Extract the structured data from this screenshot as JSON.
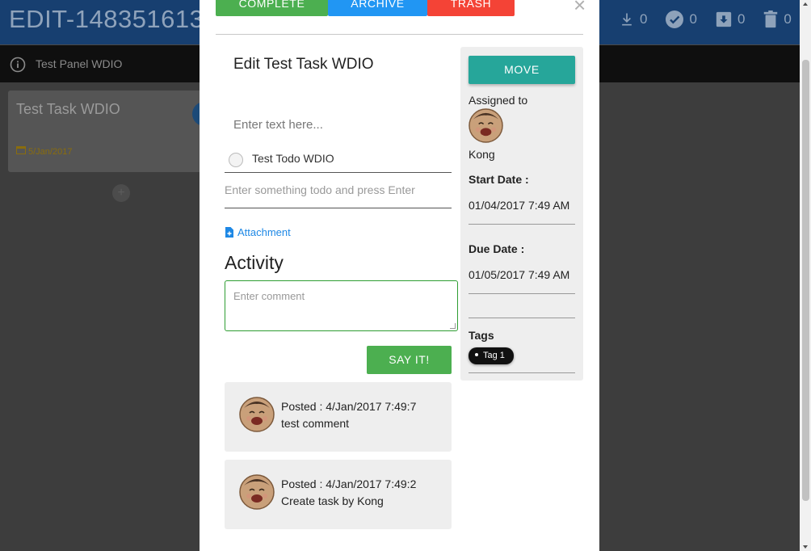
{
  "app": {
    "title": "EDIT-148351613",
    "counters": [
      {
        "icon": "download-icon",
        "value": "0"
      },
      {
        "icon": "check-circle-icon",
        "value": "0"
      },
      {
        "icon": "archive-icon",
        "value": "0"
      },
      {
        "icon": "trash-icon",
        "value": "0"
      }
    ],
    "panel_title": "Test Panel WDIO",
    "card": {
      "title": "Test Task WDIO",
      "date": "5/Jan/2017"
    },
    "add_symbol": "+"
  },
  "modal": {
    "buttons": {
      "complete": "COMPLETE",
      "archive": "ARCHIVE",
      "trash": "TRASH"
    },
    "close_symbol": "×",
    "task_title": "Edit Test Task WDIO",
    "text_placeholder": "Enter text here...",
    "todo": {
      "label": "Test Todo WDIO",
      "checked": false
    },
    "todo_placeholder": "Enter something todo and press Enter",
    "attachment_label": "Attachment",
    "activity_heading": "Activity",
    "comment_placeholder": "Enter comment",
    "say_button": "SAY IT!",
    "comments": [
      {
        "posted": "Posted : 4/Jan/2017 7:49:7",
        "text": "test comment"
      },
      {
        "posted": "Posted : 4/Jan/2017 7:49:2",
        "text": "Create task by Kong"
      }
    ]
  },
  "side": {
    "move_button": "MOVE",
    "assigned_label": "Assigned to",
    "assignee": "Kong",
    "start_label": "Start Date :",
    "start_value": "01/04/2017 7:49 AM",
    "due_label": "Due Date :",
    "due_value": "01/05/2017 7:49 AM",
    "tags_label": "Tags",
    "tags": [
      "Tag 1"
    ]
  },
  "colors": {
    "complete": "#4caf50",
    "archive": "#2196f3",
    "trash": "#f44336",
    "move": "#26a69a",
    "attachment": "#1e88e5",
    "appbar": "#173f70"
  }
}
